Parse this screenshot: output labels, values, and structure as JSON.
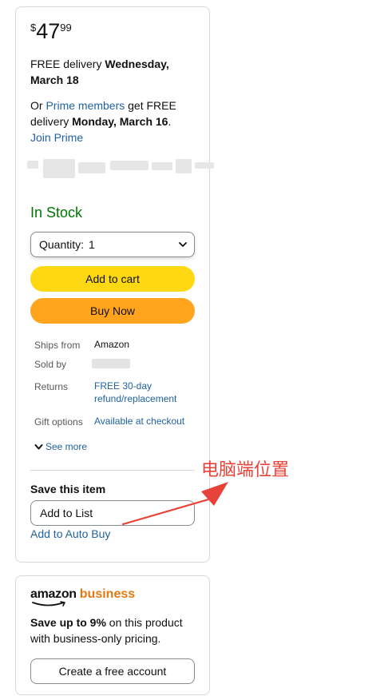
{
  "price": {
    "symbol": "$",
    "whole": "47",
    "fraction": "99"
  },
  "delivery": {
    "line1_prefix": "FREE delivery ",
    "line1_date": "Wednesday, March 18",
    "prime_prefix": "Or ",
    "prime_link": "Prime members",
    "prime_mid": " get FREE delivery ",
    "prime_date": "Monday, March 16",
    "prime_suffix": ".",
    "join_prime": "Join Prime"
  },
  "stock_status": "In Stock",
  "quantity": {
    "label": "Quantity:",
    "value": "1"
  },
  "buttons": {
    "add_to_cart": "Add to cart",
    "buy_now": "Buy Now"
  },
  "details": {
    "ships_from_label": "Ships from",
    "ships_from_value": "Amazon",
    "sold_by_label": "Sold by",
    "returns_label": "Returns",
    "returns_value": "FREE 30-day refund/replacement",
    "gift_label": "Gift options",
    "gift_value": "Available at checkout",
    "see_more": "See more"
  },
  "save": {
    "title": "Save this item",
    "add_to_list": "Add to List",
    "auto_buy": "Add to Auto Buy"
  },
  "business": {
    "logo_amazon": "amazon",
    "logo_business": "business",
    "desc_bold": "Save up to 9%",
    "desc_rest": " on this product with business-only pricing.",
    "create_account": "Create a free account"
  },
  "annotation": {
    "text": "电脑端位置",
    "color": "#e8433a"
  },
  "colors": {
    "in_stock": "#007600",
    "link": "#2162a1",
    "add_to_cart": "#ffd814",
    "buy_now": "#ffa41c",
    "business_orange": "#e47911"
  }
}
